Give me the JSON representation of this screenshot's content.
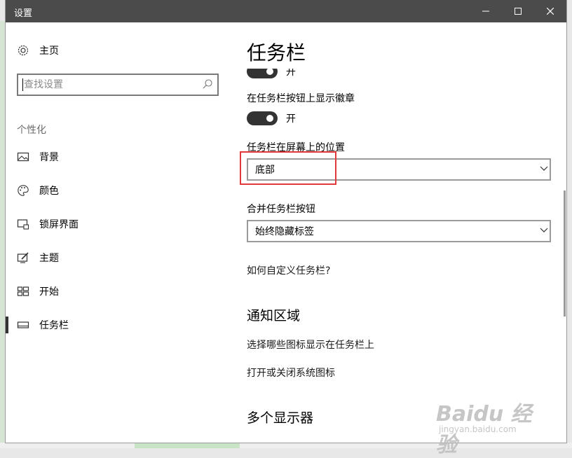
{
  "window": {
    "title": "设置"
  },
  "sidebar": {
    "home_label": "主页",
    "search_placeholder": "查找设置",
    "section_label": "个性化",
    "items": [
      {
        "label": "背景",
        "icon": "picture-icon"
      },
      {
        "label": "颜色",
        "icon": "palette-icon"
      },
      {
        "label": "锁屏界面",
        "icon": "lockscreen-icon"
      },
      {
        "label": "主题",
        "icon": "theme-icon"
      },
      {
        "label": "开始",
        "icon": "start-icon"
      },
      {
        "label": "任务栏",
        "icon": "taskbar-icon",
        "active": true
      }
    ]
  },
  "main": {
    "title": "任务栏",
    "toggle_top_state": "开",
    "badges_label": "在任务栏按钮上显示徽章",
    "badges_state": "开",
    "position_label": "任务栏在屏幕上的位置",
    "position_value": "底部",
    "combine_label": "合并任务栏按钮",
    "combine_value": "始终隐藏标签",
    "customize_link": "如何自定义任务栏?",
    "notify_heading": "通知区域",
    "notify_link1": "选择哪些图标显示在任务栏上",
    "notify_link2": "打开或关闭系统图标",
    "multi_heading": "多个显示器"
  },
  "watermark": {
    "logo": "Baidu 经验",
    "url": "jingyan.baidu.com"
  },
  "colors": {
    "titlebar": "#4b4b4b",
    "toggle_on": "#333333",
    "highlight": "#e03a3a"
  }
}
